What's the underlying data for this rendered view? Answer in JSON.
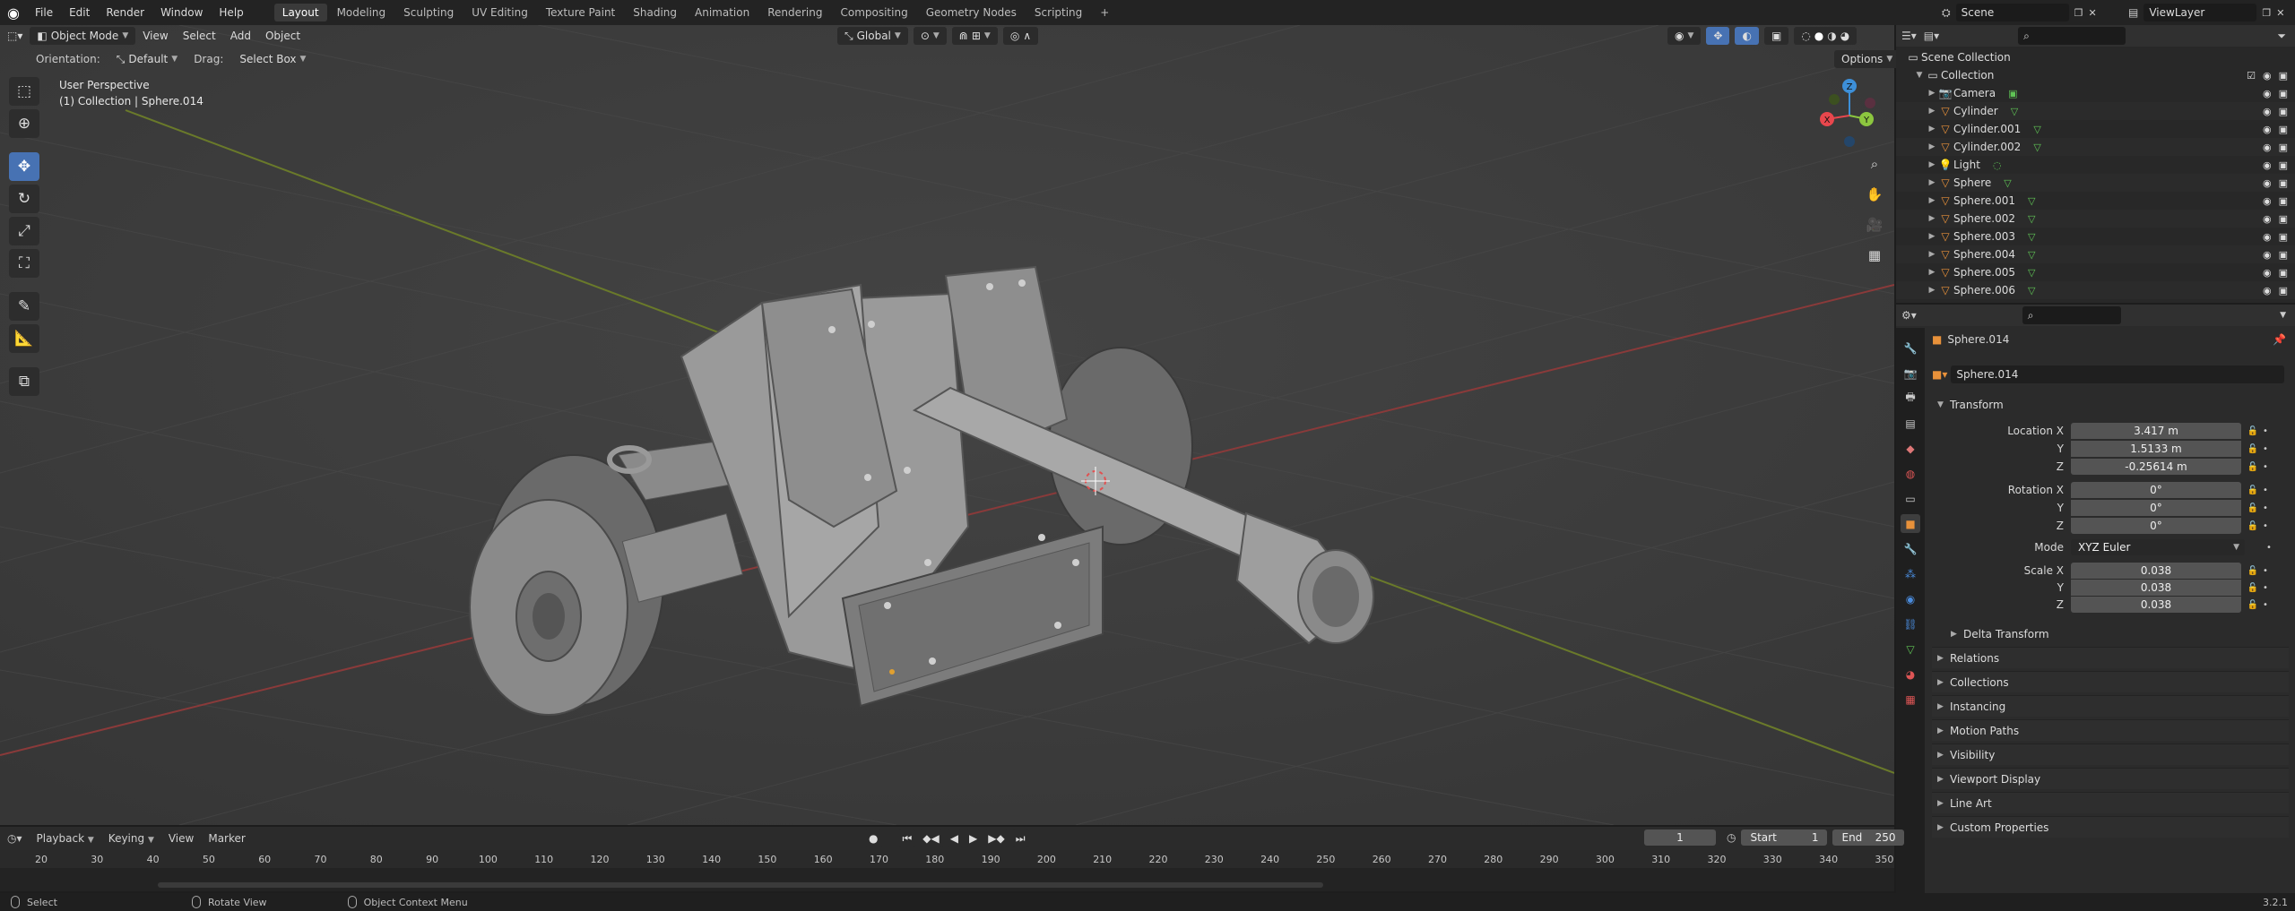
{
  "topbar": {
    "menus": [
      "File",
      "Edit",
      "Render",
      "Window",
      "Help"
    ],
    "workspaces": [
      "Layout",
      "Modeling",
      "Sculpting",
      "UV Editing",
      "Texture Paint",
      "Shading",
      "Animation",
      "Rendering",
      "Compositing",
      "Geometry Nodes",
      "Scripting"
    ],
    "active_workspace": "Layout",
    "add_workspace": "+",
    "scene": "Scene",
    "view_layer": "ViewLayer"
  },
  "viewport_header": {
    "mode": "Object Mode",
    "menus": [
      "View",
      "Select",
      "Add",
      "Object"
    ],
    "transform_orientation": "Global"
  },
  "tool_settings": {
    "orientation_label": "Orientation:",
    "orientation_value": "Default",
    "drag_label": "Drag:",
    "drag_value": "Select Box",
    "options": "Options"
  },
  "viewport_info": {
    "perspective": "User Perspective",
    "context": "(1) Collection | Sphere.014"
  },
  "gizmo": {
    "x": "X",
    "y": "Y",
    "z": "Z"
  },
  "outliner": {
    "scene_collection": "Scene Collection",
    "collection": "Collection",
    "objects": [
      {
        "name": "Camera",
        "type": "camera"
      },
      {
        "name": "Cylinder",
        "type": "mesh"
      },
      {
        "name": "Cylinder.001",
        "type": "mesh"
      },
      {
        "name": "Cylinder.002",
        "type": "mesh"
      },
      {
        "name": "Light",
        "type": "light"
      },
      {
        "name": "Sphere",
        "type": "mesh"
      },
      {
        "name": "Sphere.001",
        "type": "mesh"
      },
      {
        "name": "Sphere.002",
        "type": "mesh"
      },
      {
        "name": "Sphere.003",
        "type": "mesh"
      },
      {
        "name": "Sphere.004",
        "type": "mesh"
      },
      {
        "name": "Sphere.005",
        "type": "mesh"
      },
      {
        "name": "Sphere.006",
        "type": "mesh"
      }
    ]
  },
  "properties": {
    "object_name": "Sphere.014",
    "data_name": "Sphere.014",
    "transform_title": "Transform",
    "location_x_label": "Location X",
    "location_x": "3.417 m",
    "location_y_label": "Y",
    "location_y": "1.5133 m",
    "location_z_label": "Z",
    "location_z": "-0.25614 m",
    "rotation_x_label": "Rotation X",
    "rotation_x": "0°",
    "rotation_y_label": "Y",
    "rotation_y": "0°",
    "rotation_z_label": "Z",
    "rotation_z": "0°",
    "mode_label": "Mode",
    "mode_value": "XYZ Euler",
    "scale_x_label": "Scale X",
    "scale_x": "0.038",
    "scale_y_label": "Y",
    "scale_y": "0.038",
    "scale_z_label": "Z",
    "scale_z": "0.038",
    "delta_transform": "Delta Transform",
    "panels": [
      "Relations",
      "Collections",
      "Instancing",
      "Motion Paths",
      "Visibility",
      "Viewport Display",
      "Line Art",
      "Custom Properties"
    ]
  },
  "timeline": {
    "menus": [
      "Playback",
      "Keying",
      "View",
      "Marker"
    ],
    "current_frame": "1",
    "start_label": "Start",
    "start": "1",
    "end_label": "End",
    "end": "250",
    "ticks": [
      "20",
      "30",
      "40",
      "50",
      "60",
      "70",
      "80",
      "90",
      "100",
      "110",
      "120",
      "130",
      "140",
      "150",
      "160",
      "170",
      "180",
      "190",
      "200",
      "210",
      "220",
      "230",
      "240",
      "250",
      "260",
      "270",
      "280",
      "290",
      "300",
      "310",
      "320",
      "330",
      "340",
      "350"
    ]
  },
  "statusbar": {
    "select": "Select",
    "rotate_view": "Rotate View",
    "context_menu": "Object Context Menu",
    "version": "3.2.1"
  },
  "colors": {
    "accent": "#4772b3",
    "mesh_icon": "#e8913a",
    "data_icon": "#5fc455",
    "axis_x": "#e8474d",
    "axis_y": "#8cc63f",
    "axis_z": "#3d8fd8"
  }
}
